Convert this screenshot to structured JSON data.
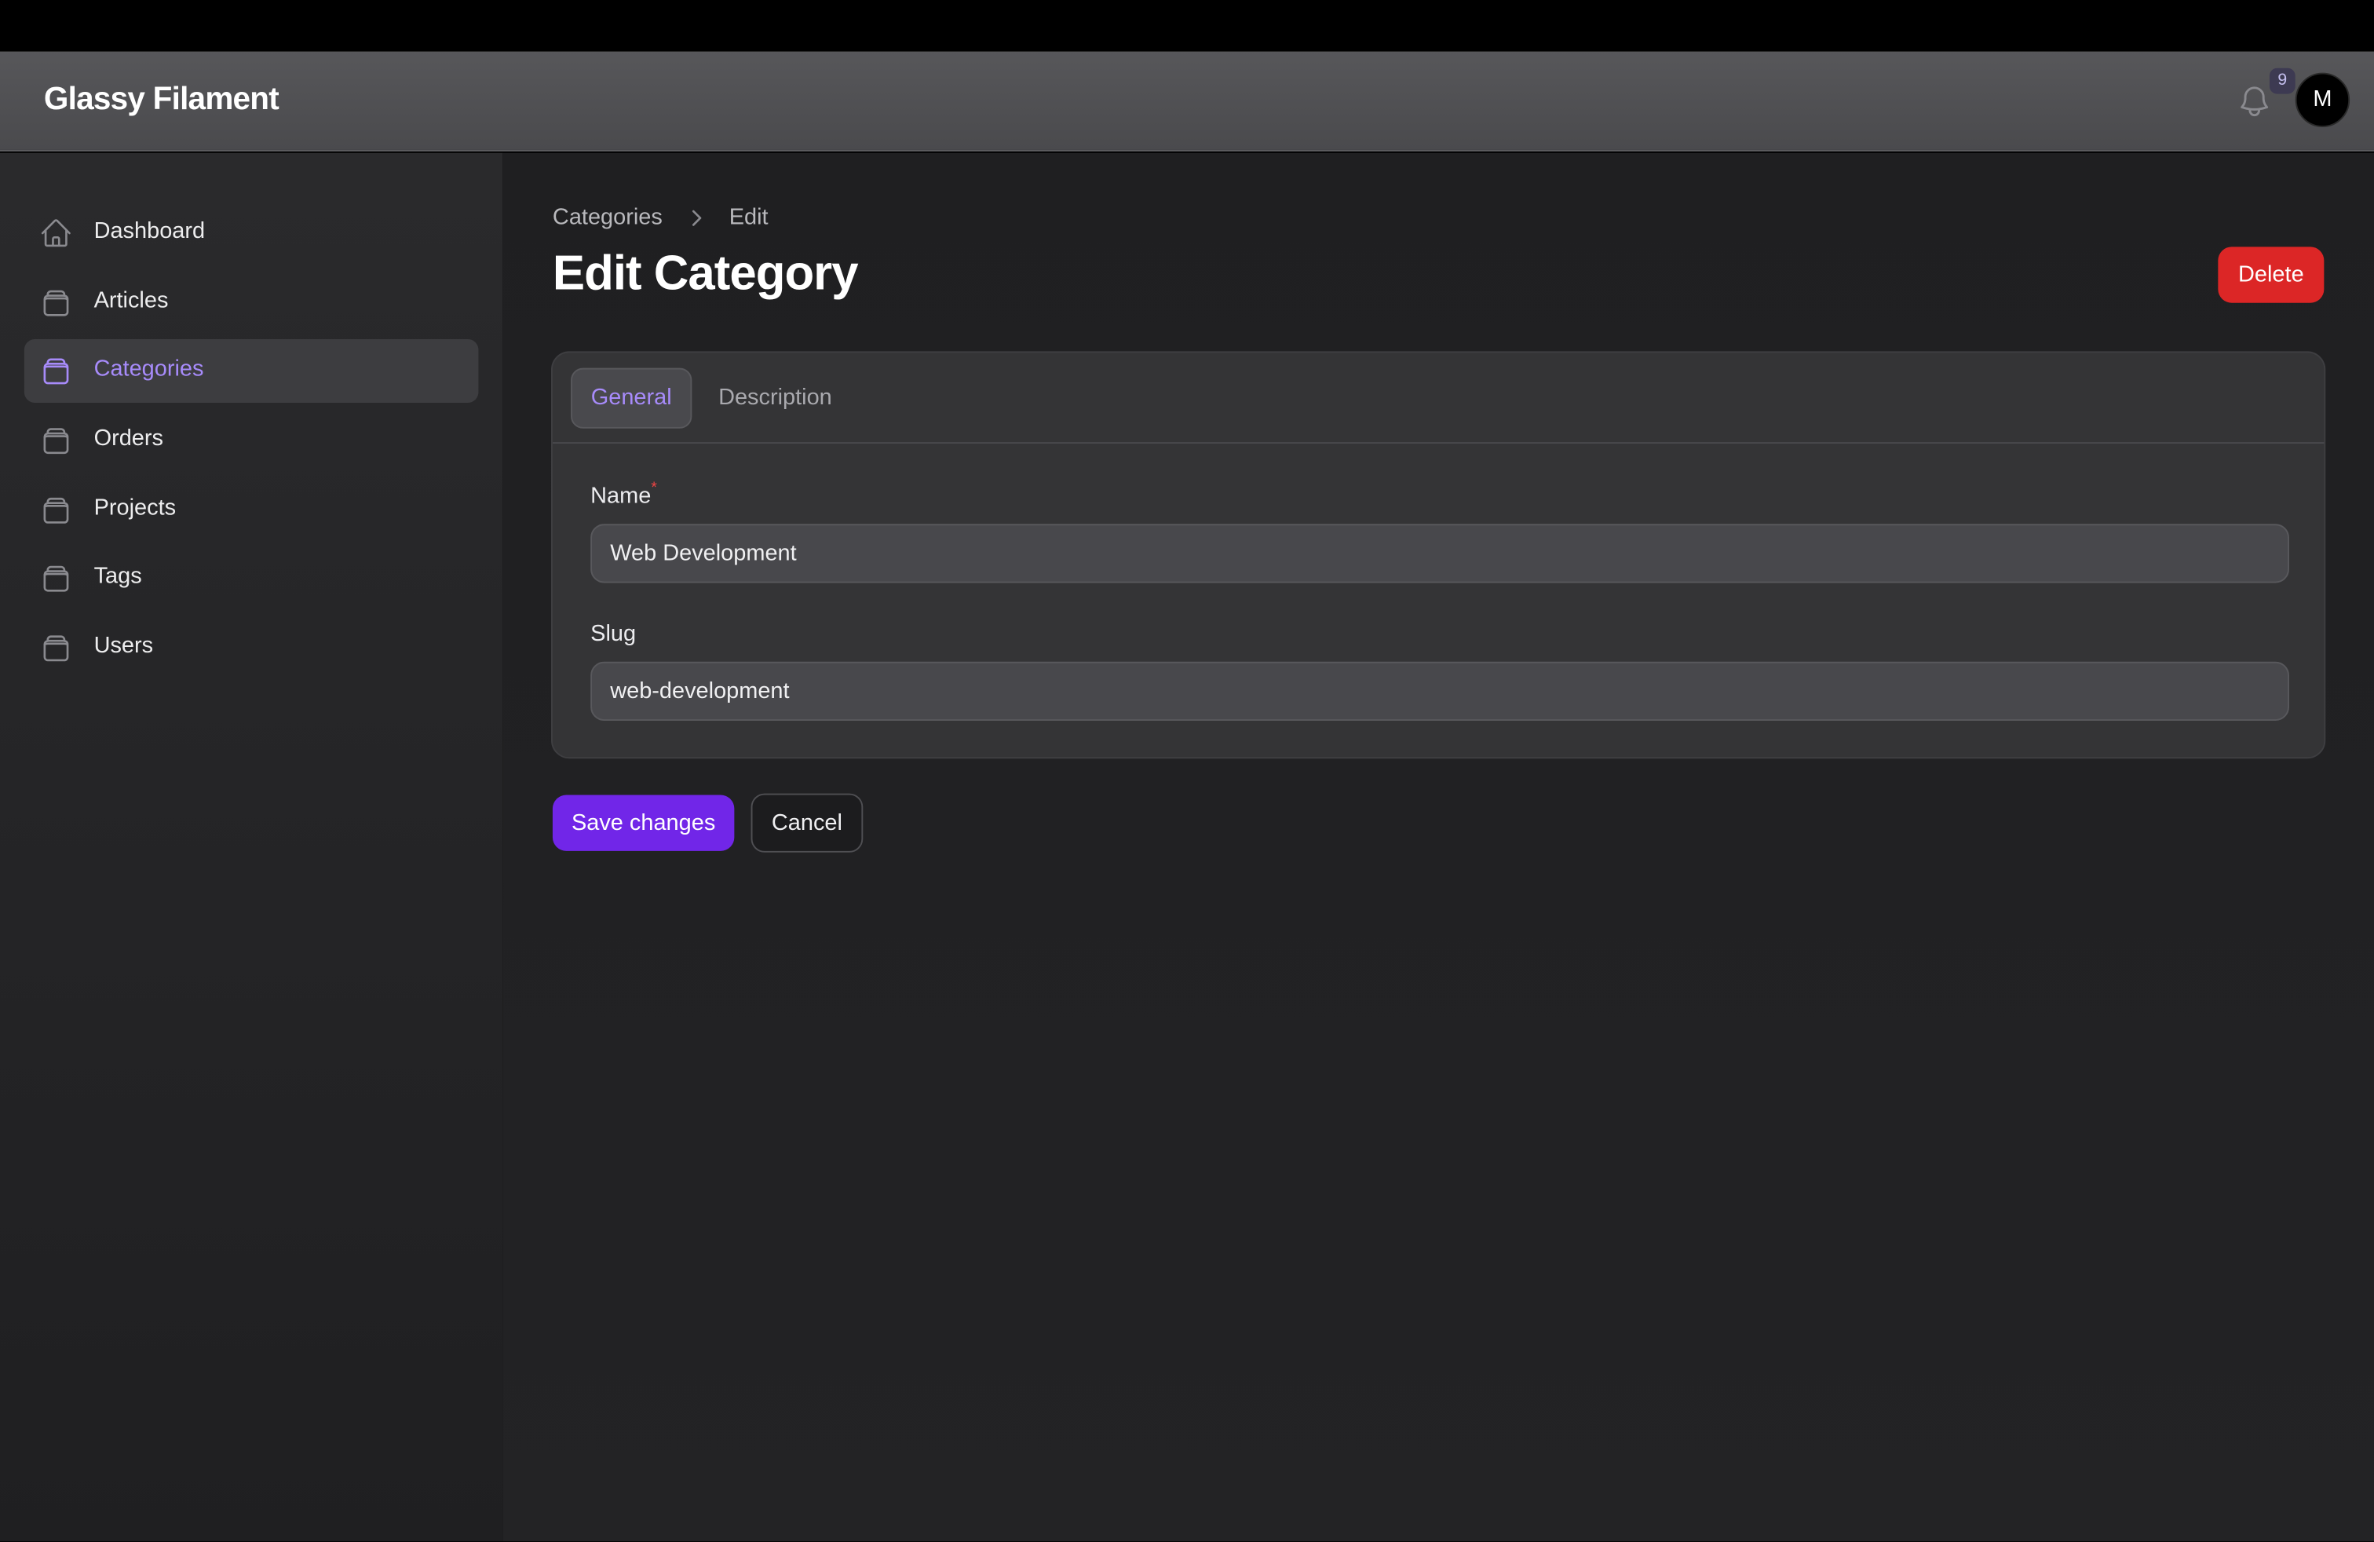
{
  "app": {
    "brand": "Glassy Filament",
    "notification_count": "9",
    "user_initial": "M"
  },
  "sidebar": {
    "items": [
      {
        "label": "Dashboard",
        "icon": "home-icon",
        "active": false
      },
      {
        "label": "Articles",
        "icon": "stack-icon",
        "active": false
      },
      {
        "label": "Categories",
        "icon": "stack-icon",
        "active": true
      },
      {
        "label": "Orders",
        "icon": "stack-icon",
        "active": false
      },
      {
        "label": "Projects",
        "icon": "stack-icon",
        "active": false
      },
      {
        "label": "Tags",
        "icon": "stack-icon",
        "active": false
      },
      {
        "label": "Users",
        "icon": "stack-icon",
        "active": false
      }
    ]
  },
  "breadcrumb": {
    "parent": "Categories",
    "current": "Edit"
  },
  "page": {
    "title": "Edit Category",
    "delete_label": "Delete"
  },
  "tabs": [
    {
      "label": "General",
      "active": true
    },
    {
      "label": "Description",
      "active": false
    }
  ],
  "form": {
    "name": {
      "label": "Name",
      "required_marker": "*",
      "value": "Web Development"
    },
    "slug": {
      "label": "Slug",
      "value": "web-development"
    }
  },
  "actions": {
    "save_label": "Save changes",
    "cancel_label": "Cancel"
  },
  "colors": {
    "accent": "#a78bfa",
    "primary_button": "#7126e8",
    "danger": "#dc2626"
  }
}
